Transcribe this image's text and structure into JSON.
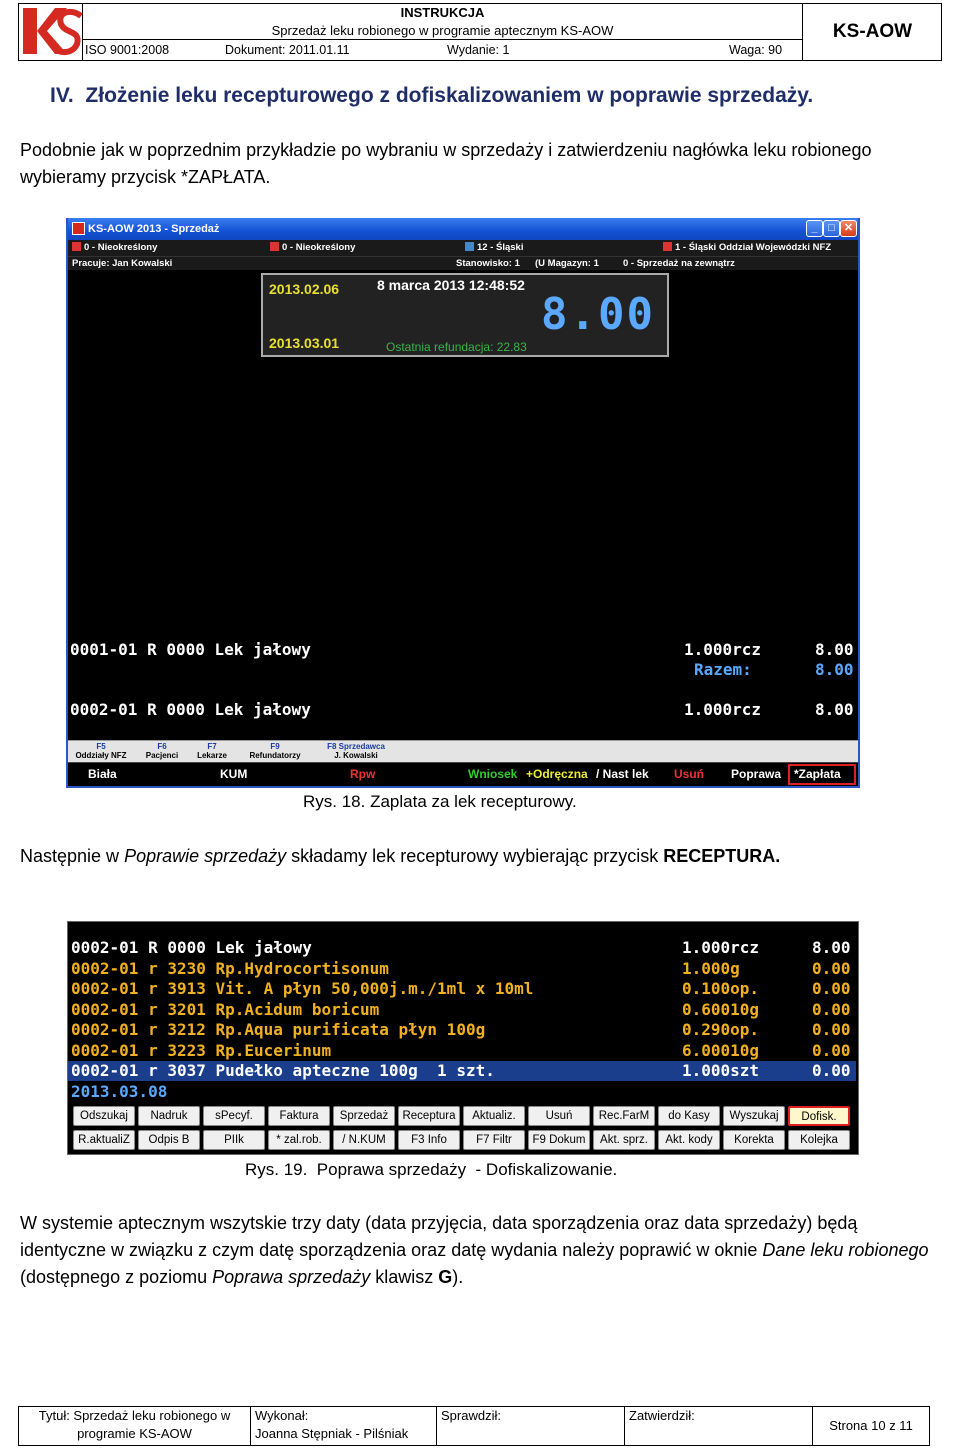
{
  "header": {
    "title": "INSTRUKCJA",
    "subtitle": "Sprzedaż leku robionego w programie aptecznym KS-AOW",
    "iso": "ISO 9001:2008",
    "dokument": "Dokument: 2011.01.11",
    "wydanie": "Wydanie: 1",
    "waga": "Waga: 90",
    "code": "KS-AOW",
    "logo_text": "KS"
  },
  "section": {
    "heading": "IV.  Złożenie leku recepturowego z dofiskalizowaniem w poprawie sprzedaży.",
    "para1_a": "Podobnie jak w poprzednim przykładzie po wybraniu w sprzedaży i zatwierdzeniu nagłówka leku robionego wybieramy przycisk ",
    "para1_b": "*ZAPŁATA",
    "para1_c": ".",
    "caption1": "Rys. 18. Zaplata za lek recepturowy.",
    "para2_a": "Następnie w ",
    "para2_b": "Poprawie sprzedaży",
    "para2_c": " składamy lek recepturowy wybierając przycisk ",
    "para2_d": "RECEPTURA.",
    "caption2": "Rys. 19.  Poprawa sprzedaży  - Dofiskalizowanie.",
    "para3_a": "W systemie aptecznym wszytskie trzy daty (data przyjęcia, data sporządzenia oraz data sprzedaży) będą identyczne w związku z czym datę sporządzenia oraz datę wydania należy poprawić w oknie ",
    "para3_b": "Dane leku robionego",
    "para3_c": " (dostępnego z poziomu ",
    "para3_d": "Poprawa sprzedaży",
    "para3_e": " klawisz ",
    "para3_f": "G",
    "para3_g": ")."
  },
  "screen1": {
    "window_title": "KS-AOW 2013 - Sprzedaż",
    "info1": [
      "0 - Nieokreślony",
      "0 - Nieokreślony",
      "12 - Śląski",
      "1 - Śląski Oddział Wojewódzki NFZ"
    ],
    "info2": [
      "Pracuje: Jan Kowalski",
      "Stanowisko: 1",
      "(U Magazyn: 1",
      "0 - Sprzedaż na zewnątrz"
    ],
    "date1": "2013.02.06",
    "date2": "2013.03.01",
    "datetime": "8 marca 2013  12:48:52",
    "amount": "8.00",
    "refund": "Ostatnia refundacja: 22.83",
    "row1": "0001-01 R 0000 Lek jałowy",
    "row1_qty": "1.000rcz",
    "row1_val": "8.00",
    "razem_label": "Razem:",
    "razem_val": "8.00",
    "row2": "0002-01 R 0000 Lek jałowy",
    "row2_qty": "1.000rcz",
    "row2_val": "8.00",
    "fkeys": [
      {
        "key": "F5",
        "label": "Oddziały NFZ"
      },
      {
        "key": "F6",
        "label": "Pacjenci"
      },
      {
        "key": "F7",
        "label": "Lekarze"
      },
      {
        "key": "F9",
        "label": "Refundatorzy"
      },
      {
        "key": "F8 Sprzedawca",
        "label": "J. Kowalski"
      }
    ],
    "status": {
      "biala": "Biała",
      "kum": "KUM",
      "rpw": "Rpw",
      "wniosek": "Wniosek",
      "odreczna": "+Odręczna",
      "nastlek": "/ Nast lek",
      "usun": "Usuń",
      "poprawa": "Poprawa",
      "zaplata": "*Zapłata"
    }
  },
  "screen2": {
    "rows": [
      {
        "text": "0002-01 R 0000 Lek jałowy",
        "qty": "1.000rcz",
        "val": "8.00",
        "color": "#ffffff"
      },
      {
        "text": "0002-01 r 3230 Rp.Hydrocortisonum",
        "qty": "1.000g",
        "val": "0.00",
        "color": "#f0b020"
      },
      {
        "text": "0002-01 r 3913 Vit. A płyn 50,000j.m./1ml x 10ml",
        "qty": "0.100op.",
        "val": "0.00",
        "color": "#f0b020"
      },
      {
        "text": "0002-01 r 3201 Rp.Acidum boricum",
        "qty": "0.60010g",
        "val": "0.00",
        "color": "#f0b020"
      },
      {
        "text": "0002-01 r 3212 Rp.Aqua purificata płyn 100g",
        "qty": "0.290op.",
        "val": "0.00",
        "color": "#f0b020"
      },
      {
        "text": "0002-01 r 3223 Rp.Eucerinum",
        "qty": "6.00010g",
        "val": "0.00",
        "color": "#f0b020"
      },
      {
        "text": "0002-01 r 3037 Pudełko apteczne 100g  1 szt.",
        "qty": "1.000szt",
        "val": "0.00",
        "color": "#ffffff"
      }
    ],
    "date": "2013.03.08",
    "buttons_row1": [
      "Odszukaj",
      "Nadruk",
      "sPecyf.",
      "Faktura",
      "Sprzedaż",
      "Receptura",
      "Aktualiz.",
      "Usuń",
      "Rec.FarM",
      "do Kasy",
      "Wyszukaj",
      "Dofisk."
    ],
    "buttons_row2": [
      "R.aktualiZ",
      "Odpis B",
      "PIIk",
      "* zal.rob.",
      "/ N.KUM",
      "F3 Info",
      "F7 Filtr",
      "F9 Dokum",
      "Akt. sprz.",
      "Akt. kody",
      "Korekta",
      "Kolejka"
    ]
  },
  "footer": {
    "tytul_1": "Tytuł: Sprzedaż leku robionego w",
    "tytul_2": "programie KS-AOW",
    "wykonal_1": "Wykonał:",
    "wykonal_2": "Joanna Stępniak - Pilśniak",
    "sprawdzil": "Sprawdził:",
    "zatwierdzil": "Zatwierdził:",
    "strona": "Strona 10 z 11"
  }
}
